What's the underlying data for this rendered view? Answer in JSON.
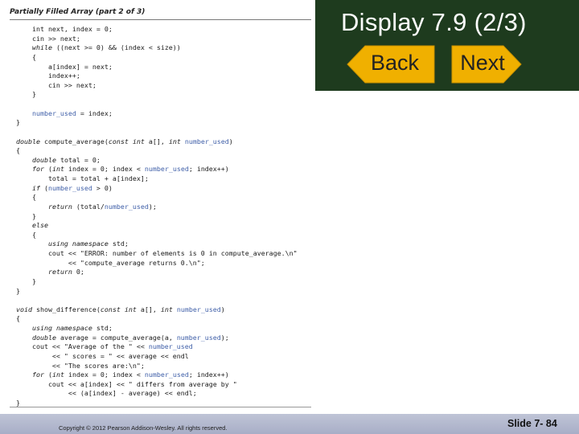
{
  "code": {
    "title": "Partially Filled Array (part 2 of 3)",
    "lines": [
      [
        {
          "t": "        int next, index = 0;"
        }
      ],
      [
        {
          "t": "        cin >> next;"
        }
      ],
      [
        {
          "t": "        ",
          "k": ""
        },
        {
          "t": "while",
          "k": "kw"
        },
        {
          "t": " ((next >= 0) && (index < size))"
        }
      ],
      [
        {
          "t": "        {"
        }
      ],
      [
        {
          "t": "            a[index] = next;"
        }
      ],
      [
        {
          "t": "            index++;"
        }
      ],
      [
        {
          "t": "            cin >> next;"
        }
      ],
      [
        {
          "t": "        }"
        }
      ],
      [
        {
          "t": ""
        }
      ],
      [
        {
          "t": "        "
        },
        {
          "t": "number_used",
          "k": "id"
        },
        {
          "t": " = index;"
        }
      ],
      [
        {
          "t": "    }"
        }
      ],
      [
        {
          "t": ""
        }
      ],
      [
        {
          "t": "    "
        },
        {
          "t": "double",
          "k": "kw"
        },
        {
          "t": " compute_average("
        },
        {
          "t": "const int",
          "k": "kw"
        },
        {
          "t": " a[], "
        },
        {
          "t": "int",
          "k": "kw"
        },
        {
          "t": " "
        },
        {
          "t": "number_used",
          "k": "id"
        },
        {
          "t": ")"
        }
      ],
      [
        {
          "t": "    {"
        }
      ],
      [
        {
          "t": "        "
        },
        {
          "t": "double",
          "k": "kw"
        },
        {
          "t": " total = 0;"
        }
      ],
      [
        {
          "t": "        "
        },
        {
          "t": "for",
          "k": "kw"
        },
        {
          "t": " ("
        },
        {
          "t": "int",
          "k": "kw"
        },
        {
          "t": " index = 0; index < "
        },
        {
          "t": "number_used",
          "k": "id"
        },
        {
          "t": "; index++)"
        }
      ],
      [
        {
          "t": "            total = total + a[index];"
        }
      ],
      [
        {
          "t": "        "
        },
        {
          "t": "if",
          "k": "kw"
        },
        {
          "t": " ("
        },
        {
          "t": "number_used",
          "k": "id"
        },
        {
          "t": " > 0)"
        }
      ],
      [
        {
          "t": "        {"
        }
      ],
      [
        {
          "t": "            "
        },
        {
          "t": "return",
          "k": "kw"
        },
        {
          "t": " (total/"
        },
        {
          "t": "number_used",
          "k": "id"
        },
        {
          "t": ");"
        }
      ],
      [
        {
          "t": "        }"
        }
      ],
      [
        {
          "t": "        "
        },
        {
          "t": "else",
          "k": "kw"
        }
      ],
      [
        {
          "t": "        {"
        }
      ],
      [
        {
          "t": "            "
        },
        {
          "t": "using namespace",
          "k": "kw"
        },
        {
          "t": " std;"
        }
      ],
      [
        {
          "t": "            cout << \"ERROR: number of elements is 0 in compute_average.\\n\""
        }
      ],
      [
        {
          "t": "                 << \"compute_average returns 0.\\n\";"
        }
      ],
      [
        {
          "t": "            "
        },
        {
          "t": "return",
          "k": "kw"
        },
        {
          "t": " 0;"
        }
      ],
      [
        {
          "t": "        }"
        }
      ],
      [
        {
          "t": "    }"
        }
      ],
      [
        {
          "t": ""
        }
      ],
      [
        {
          "t": "    "
        },
        {
          "t": "void",
          "k": "kw"
        },
        {
          "t": " show_difference("
        },
        {
          "t": "const int",
          "k": "kw"
        },
        {
          "t": " a[], "
        },
        {
          "t": "int",
          "k": "kw"
        },
        {
          "t": " "
        },
        {
          "t": "number_used",
          "k": "id"
        },
        {
          "t": ")"
        }
      ],
      [
        {
          "t": "    {"
        }
      ],
      [
        {
          "t": "        "
        },
        {
          "t": "using namespace",
          "k": "kw"
        },
        {
          "t": " std;"
        }
      ],
      [
        {
          "t": "        "
        },
        {
          "t": "double",
          "k": "kw"
        },
        {
          "t": " average = compute_average(a, "
        },
        {
          "t": "number_used",
          "k": "id"
        },
        {
          "t": ");"
        }
      ],
      [
        {
          "t": "        cout << \"Average of the \" << "
        },
        {
          "t": "number_used",
          "k": "id"
        }
      ],
      [
        {
          "t": "             << \" scores = \" << average << endl"
        }
      ],
      [
        {
          "t": "             << \"The scores are:\\n\";"
        }
      ],
      [
        {
          "t": "        "
        },
        {
          "t": "for",
          "k": "kw"
        },
        {
          "t": " ("
        },
        {
          "t": "int",
          "k": "kw"
        },
        {
          "t": " index = 0; index < "
        },
        {
          "t": "number_used",
          "k": "id"
        },
        {
          "t": "; index++)"
        }
      ],
      [
        {
          "t": "            cout << a[index] << \" differs from average by \""
        }
      ],
      [
        {
          "t": "                 << (a[index] - average) << endl;"
        }
      ],
      [
        {
          "t": "    }"
        }
      ]
    ]
  },
  "header": {
    "title": "Display 7.9  (2/3)",
    "back_label": "Back",
    "next_label": "Next"
  },
  "footer": {
    "copyright": "Copyright © 2012 Pearson Addison-Wesley.  All rights reserved.",
    "slide_number": "Slide 7- 84"
  },
  "colors": {
    "header_bg": "#1e3b1e",
    "button_fill": "#f0b000",
    "identifier": "#3f5fa8"
  }
}
